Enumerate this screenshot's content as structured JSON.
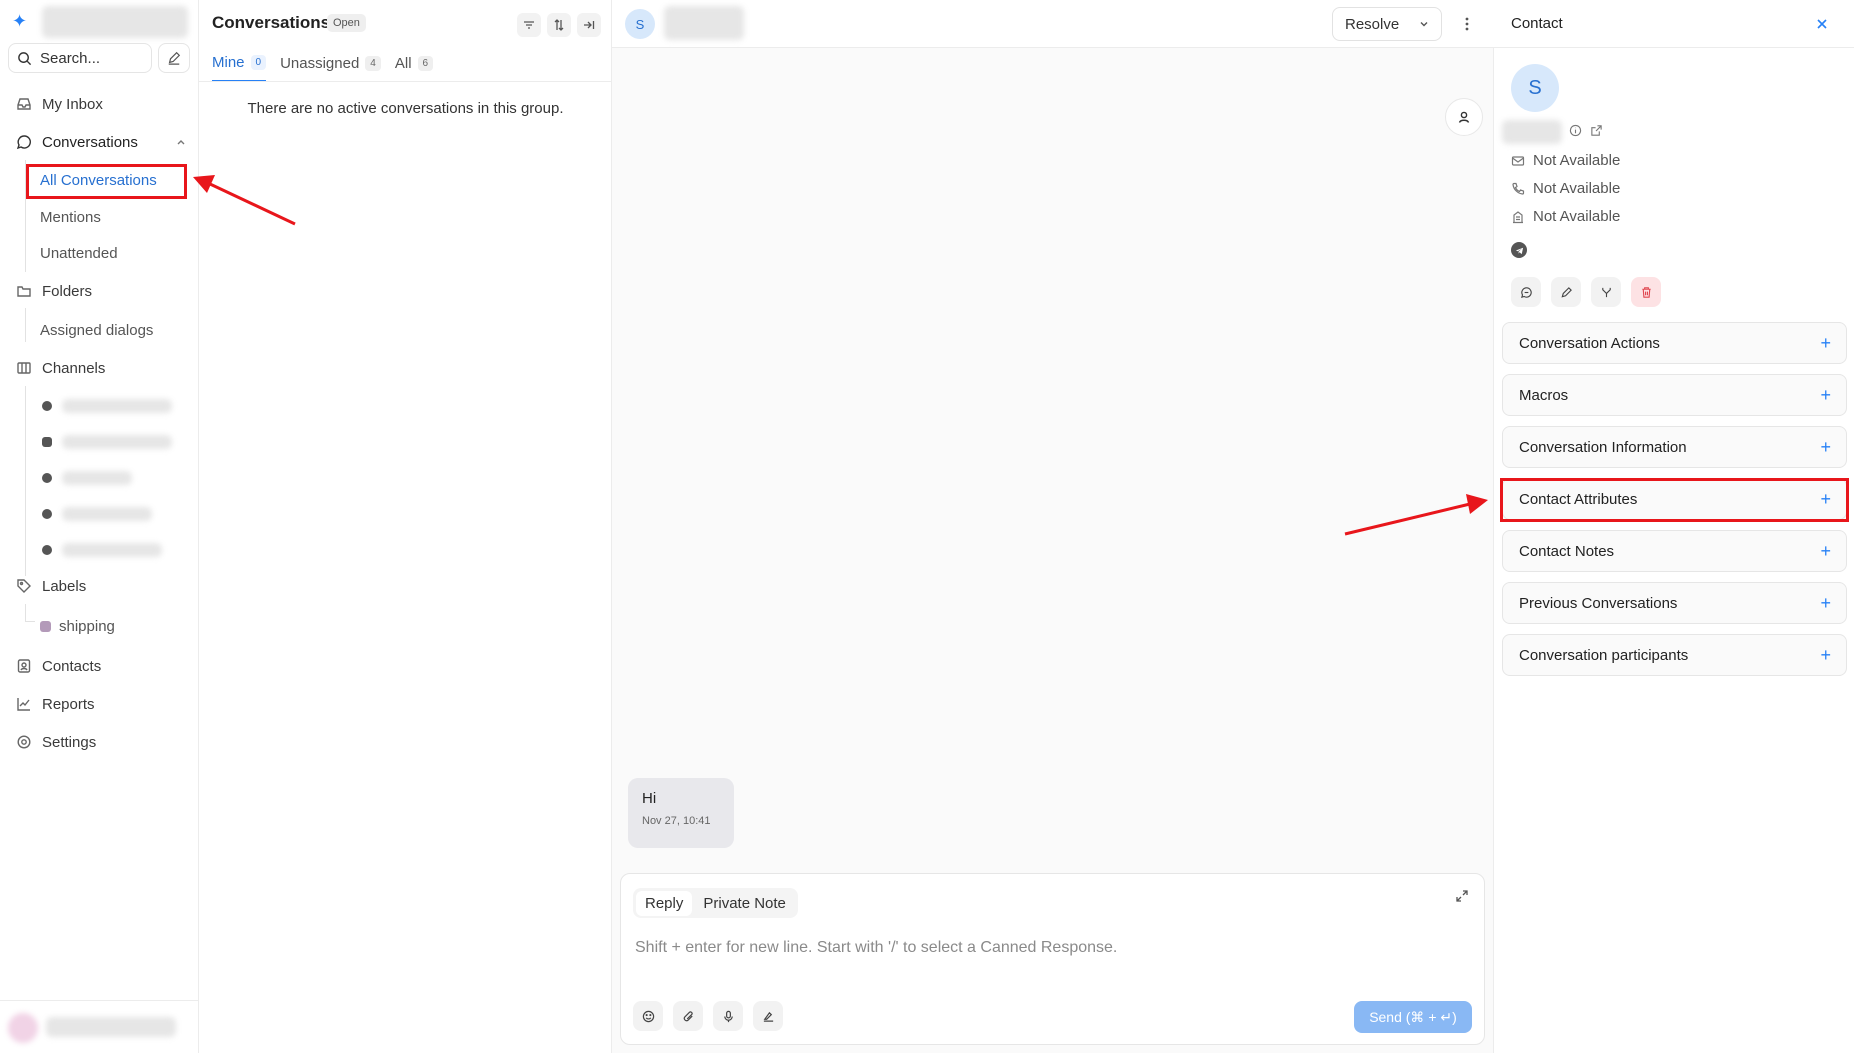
{
  "sidebar": {
    "search_label": "Search...",
    "nav": {
      "my_inbox": "My Inbox",
      "conversations": "Conversations",
      "all_conversations": "All Conversations",
      "mentions": "Mentions",
      "unattended": "Unattended",
      "folders": "Folders",
      "assigned_dialogs": "Assigned dialogs",
      "channels": "Channels",
      "labels": "Labels",
      "label_shipping": "shipping",
      "contacts": "Contacts",
      "reports": "Reports",
      "settings": "Settings"
    },
    "label_color": "#b39ab9"
  },
  "conversation_list": {
    "title": "Conversations",
    "status_badge": "Open",
    "tabs": [
      {
        "label": "Mine",
        "count": "0"
      },
      {
        "label": "Unassigned",
        "count": "4"
      },
      {
        "label": "All",
        "count": "6"
      }
    ],
    "empty_message": "There are no active conversations in this group."
  },
  "chat": {
    "avatar_initial": "S",
    "resolve_label": "Resolve",
    "message": {
      "text": "Hi",
      "time": "Nov 27, 10:41"
    },
    "composer": {
      "tabs": [
        "Reply",
        "Private Note"
      ],
      "placeholder": "Shift + enter for new line. Start with '/' to select a Canned Response.",
      "send_label": "Send (⌘ + ↵)"
    }
  },
  "contact_panel": {
    "title": "Contact",
    "avatar_initial": "S",
    "email": "Not Available",
    "phone": "Not Available",
    "company": "Not Available",
    "sections": [
      "Conversation Actions",
      "Macros",
      "Conversation Information",
      "Contact Attributes",
      "Contact Notes",
      "Previous Conversations",
      "Conversation participants"
    ]
  },
  "colors": {
    "accent": "#2781f6",
    "highlight_box": "#e8161b"
  }
}
